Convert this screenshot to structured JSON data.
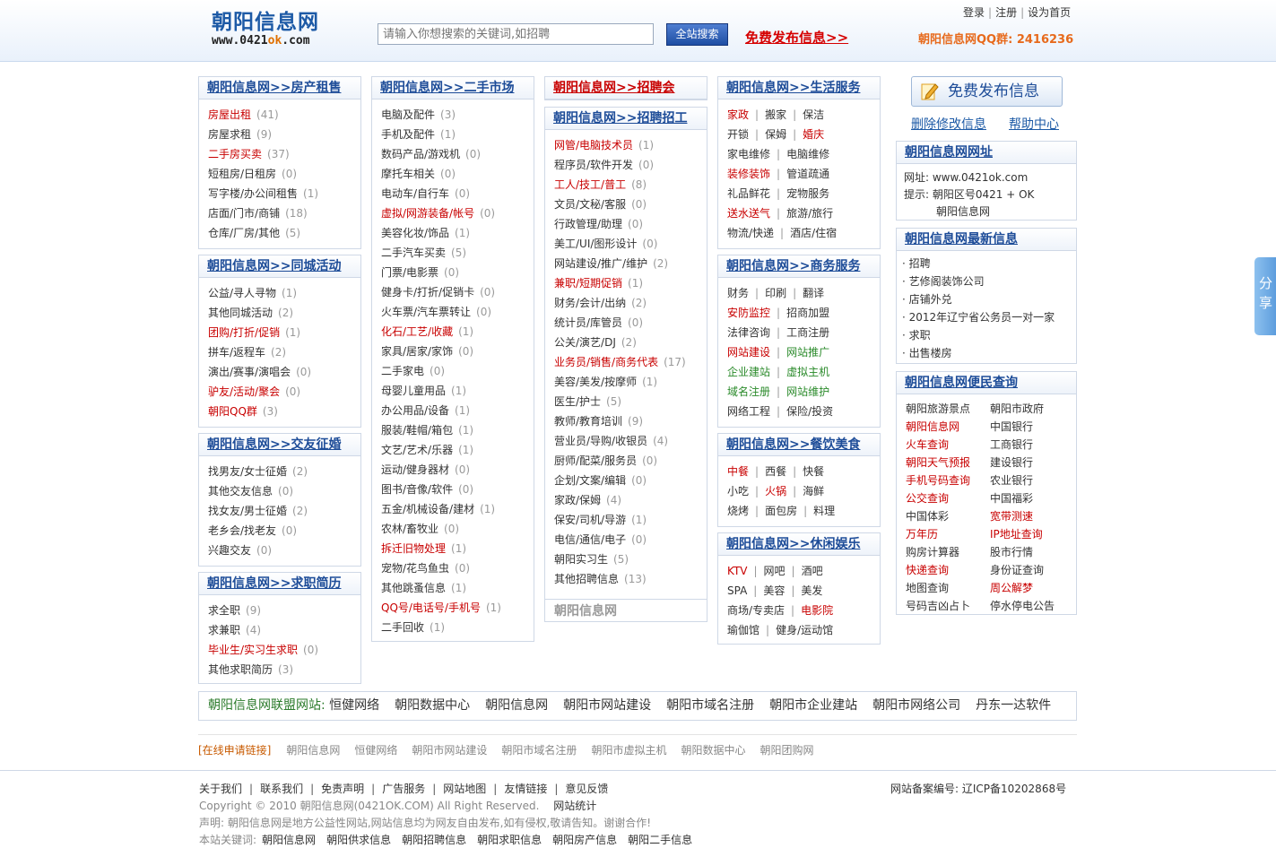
{
  "header": {
    "logo_title": "朝阳信息网",
    "logo_url_a": "www.0421",
    "logo_url_b": "ok",
    "logo_url_c": ".com",
    "search_placeholder": "请输入你想搜索的关键词,如招聘",
    "search_button": "全站搜索",
    "publish_link": "免费发布信息>>",
    "login": "登录",
    "register": "注册",
    "set_home": "设为首页",
    "qq_group": "朝阳信息网QQ群: 2416236"
  },
  "house": {
    "title": "朝阳信息网>>房产租售",
    "items": [
      {
        "label": "房屋出租",
        "count": "(41)",
        "red": true
      },
      {
        "label": "房屋求租",
        "count": "(9)",
        "red": false
      },
      {
        "label": "二手房买卖",
        "count": "(37)",
        "red": true
      },
      {
        "label": "短租房/日租房",
        "count": "(0)",
        "red": false
      },
      {
        "label": "写字楼/办公间租售",
        "count": "(1)",
        "red": false
      },
      {
        "label": "店面/门市/商铺",
        "count": "(18)",
        "red": false
      },
      {
        "label": "仓库/厂房/其他",
        "count": "(5)",
        "red": false
      }
    ]
  },
  "activity": {
    "title": "朝阳信息网>>同城活动",
    "items": [
      {
        "label": "公益/寻人寻物",
        "count": "(1)",
        "red": false
      },
      {
        "label": "其他同城活动",
        "count": "(2)",
        "red": false
      },
      {
        "label": "团购/打折/促销",
        "count": "(1)",
        "red": true
      },
      {
        "label": "拼车/返程车",
        "count": "(2)",
        "red": false
      },
      {
        "label": "演出/赛事/演唱会",
        "count": "(0)",
        "red": false
      },
      {
        "label": "驴友/活动/聚会",
        "count": "(0)",
        "red": true
      },
      {
        "label": "朝阳QQ群",
        "count": "(3)",
        "red": true
      }
    ]
  },
  "dating": {
    "title": "朝阳信息网>>交友征婚",
    "items": [
      {
        "label": "找男友/女士征婚",
        "count": "(2)",
        "red": false
      },
      {
        "label": "其他交友信息",
        "count": "(0)",
        "red": false
      },
      {
        "label": "找女友/男士征婚",
        "count": "(2)",
        "red": false
      },
      {
        "label": "老乡会/找老友",
        "count": "(0)",
        "red": false
      },
      {
        "label": "兴趣交友",
        "count": "(0)",
        "red": false
      }
    ]
  },
  "resume": {
    "title": "朝阳信息网>>求职简历",
    "items": [
      {
        "label": "求全职",
        "count": "(9)",
        "red": false
      },
      {
        "label": "求兼职",
        "count": "(4)",
        "red": false
      },
      {
        "label": "毕业生/实习生求职",
        "count": "(0)",
        "red": true
      },
      {
        "label": "其他求职简历",
        "count": "(3)",
        "red": false
      }
    ]
  },
  "secondhand": {
    "title": "朝阳信息网>>二手市场",
    "items": [
      {
        "label": "电脑及配件",
        "count": "(3)",
        "red": false
      },
      {
        "label": "手机及配件",
        "count": "(1)",
        "red": false
      },
      {
        "label": "数码产品/游戏机",
        "count": "(0)",
        "red": false
      },
      {
        "label": "摩托车相关",
        "count": "(0)",
        "red": false
      },
      {
        "label": "电动车/自行车",
        "count": "(0)",
        "red": false
      },
      {
        "label": "虚拟/网游装备/帐号",
        "count": "(0)",
        "red": true
      },
      {
        "label": "美容化妆/饰品",
        "count": "(1)",
        "red": false
      },
      {
        "label": "二手汽车买卖",
        "count": "(5)",
        "red": false
      },
      {
        "label": "门票/电影票",
        "count": "(0)",
        "red": false
      },
      {
        "label": "健身卡/打折/促销卡",
        "count": "(0)",
        "red": false
      },
      {
        "label": "火车票/汽车票转让",
        "count": "(0)",
        "red": false
      },
      {
        "label": "化石/工艺/收藏",
        "count": "(1)",
        "red": true
      },
      {
        "label": "家具/居家/家饰",
        "count": "(0)",
        "red": false
      },
      {
        "label": "二手家电",
        "count": "(0)",
        "red": false
      },
      {
        "label": "母婴儿童用品",
        "count": "(1)",
        "red": false
      },
      {
        "label": "办公用品/设备",
        "count": "(1)",
        "red": false
      },
      {
        "label": "服装/鞋帽/箱包",
        "count": "(1)",
        "red": false
      },
      {
        "label": "文艺/艺术/乐器",
        "count": "(1)",
        "red": false
      },
      {
        "label": "运动/健身器材",
        "count": "(0)",
        "red": false
      },
      {
        "label": "图书/音像/软件",
        "count": "(0)",
        "red": false
      },
      {
        "label": "五金/机械设备/建材",
        "count": "(1)",
        "red": false
      },
      {
        "label": "农林/畜牧业",
        "count": "(0)",
        "red": false
      },
      {
        "label": "拆迁旧物处理",
        "count": "(1)",
        "red": true
      },
      {
        "label": "宠物/花鸟鱼虫",
        "count": "(0)",
        "red": false
      },
      {
        "label": "其他跳蚤信息",
        "count": "(1)",
        "red": false
      },
      {
        "label": "QQ号/电话号/手机号",
        "count": "(1)",
        "red": true
      },
      {
        "label": "二手回收",
        "count": "(1)",
        "red": false
      }
    ]
  },
  "fair": {
    "title": "朝阳信息网>>招聘会"
  },
  "jobs": {
    "title": "朝阳信息网>>招聘招工",
    "footer": "朝阳信息网",
    "items": [
      {
        "label": "网管/电脑技术员",
        "count": "(1)",
        "red": true
      },
      {
        "label": "程序员/软件开发",
        "count": "(0)",
        "red": false
      },
      {
        "label": "工人/技工/普工",
        "count": "(8)",
        "red": true
      },
      {
        "label": "文员/文秘/客服",
        "count": "(0)",
        "red": false
      },
      {
        "label": "行政管理/助理",
        "count": "(0)",
        "red": false
      },
      {
        "label": "美工/UI/图形设计",
        "count": "(0)",
        "red": false
      },
      {
        "label": "网站建设/推广/维护",
        "count": "(2)",
        "red": false
      },
      {
        "label": "兼职/短期促销",
        "count": "(1)",
        "red": true
      },
      {
        "label": "财务/会计/出纳",
        "count": "(2)",
        "red": false
      },
      {
        "label": "统计员/库管员",
        "count": "(0)",
        "red": false
      },
      {
        "label": "公关/演艺/DJ",
        "count": "(2)",
        "red": false
      },
      {
        "label": "业务员/销售/商务代表",
        "count": "(17)",
        "red": true
      },
      {
        "label": "美容/美发/按摩师",
        "count": "(1)",
        "red": false
      },
      {
        "label": "医生/护士",
        "count": "(5)",
        "red": false
      },
      {
        "label": "教师/教育培训",
        "count": "(9)",
        "red": false
      },
      {
        "label": "营业员/导购/收银员",
        "count": "(4)",
        "red": false
      },
      {
        "label": "厨师/配菜/服务员",
        "count": "(0)",
        "red": false
      },
      {
        "label": "企划/文案/编辑",
        "count": "(0)",
        "red": false
      },
      {
        "label": "家政/保姆",
        "count": "(4)",
        "red": false
      },
      {
        "label": "保安/司机/导游",
        "count": "(1)",
        "red": false
      },
      {
        "label": "电信/通信/电子",
        "count": "(0)",
        "red": false
      },
      {
        "label": "朝阳实习生",
        "count": "(5)",
        "red": false
      },
      {
        "label": "其他招聘信息",
        "count": "(13)",
        "red": false
      }
    ]
  },
  "life": {
    "title": "朝阳信息网>>生活服务",
    "rows": [
      [
        {
          "t": "家政",
          "c": "red"
        },
        {
          "t": "搬家",
          "c": ""
        },
        {
          "t": "保洁",
          "c": ""
        }
      ],
      [
        {
          "t": "开锁",
          "c": ""
        },
        {
          "t": "保姆",
          "c": ""
        },
        {
          "t": "婚庆",
          "c": "red"
        }
      ],
      [
        {
          "t": "家电维修",
          "c": ""
        },
        {
          "t": "电脑维修",
          "c": ""
        }
      ],
      [
        {
          "t": "装修装饰",
          "c": "red"
        },
        {
          "t": "管道疏通",
          "c": ""
        }
      ],
      [
        {
          "t": "礼品鲜花",
          "c": ""
        },
        {
          "t": "宠物服务",
          "c": ""
        }
      ],
      [
        {
          "t": "送水送气",
          "c": "red"
        },
        {
          "t": "旅游/旅行",
          "c": ""
        }
      ],
      [
        {
          "t": "物流/快递",
          "c": ""
        },
        {
          "t": "酒店/住宿",
          "c": ""
        }
      ]
    ]
  },
  "business": {
    "title": "朝阳信息网>>商务服务",
    "rows": [
      [
        {
          "t": "财务",
          "c": ""
        },
        {
          "t": "印刷",
          "c": ""
        },
        {
          "t": "翻译",
          "c": ""
        }
      ],
      [
        {
          "t": "安防监控",
          "c": "red"
        },
        {
          "t": "招商加盟",
          "c": ""
        }
      ],
      [
        {
          "t": "法律咨询",
          "c": ""
        },
        {
          "t": "工商注册",
          "c": ""
        }
      ],
      [
        {
          "t": "网站建设",
          "c": "red"
        },
        {
          "t": "网站推广",
          "c": "green"
        }
      ],
      [
        {
          "t": "企业建站",
          "c": "green"
        },
        {
          "t": "虚拟主机",
          "c": "green"
        }
      ],
      [
        {
          "t": "域名注册",
          "c": "green"
        },
        {
          "t": "网站维护",
          "c": "green"
        }
      ],
      [
        {
          "t": "网络工程",
          "c": ""
        },
        {
          "t": "保险/投资",
          "c": ""
        }
      ]
    ]
  },
  "food": {
    "title": "朝阳信息网>>餐饮美食",
    "rows": [
      [
        {
          "t": "中餐",
          "c": "red"
        },
        {
          "t": "西餐",
          "c": ""
        },
        {
          "t": "快餐",
          "c": ""
        }
      ],
      [
        {
          "t": "小吃",
          "c": ""
        },
        {
          "t": "火锅",
          "c": "red"
        },
        {
          "t": "海鲜",
          "c": ""
        }
      ],
      [
        {
          "t": "烧烤",
          "c": ""
        },
        {
          "t": "面包房",
          "c": ""
        },
        {
          "t": "料理",
          "c": ""
        }
      ]
    ]
  },
  "leisure": {
    "title": "朝阳信息网>>休闲娱乐",
    "rows": [
      [
        {
          "t": "KTV",
          "c": "red"
        },
        {
          "t": "网吧",
          "c": ""
        },
        {
          "t": "酒吧",
          "c": ""
        }
      ],
      [
        {
          "t": "SPA",
          "c": ""
        },
        {
          "t": "美容",
          "c": ""
        },
        {
          "t": "美发",
          "c": ""
        }
      ],
      [
        {
          "t": "商场/专卖店",
          "c": ""
        },
        {
          "t": "电影院",
          "c": "red"
        }
      ],
      [
        {
          "t": "瑜伽馆",
          "c": ""
        },
        {
          "t": "健身/运动馆",
          "c": ""
        }
      ]
    ]
  },
  "sidebar": {
    "publish_button": "免费发布信息",
    "delete_edit": "删除修改信息",
    "help": "帮助中心",
    "site_title": "朝阳信息网网址",
    "site_line1": "网址: www.0421ok.com",
    "site_line2": "提示: 朝阳区号0421 + OK",
    "site_line3": "朝阳信息网",
    "latest_title": "朝阳信息网最新信息",
    "latest": [
      "招聘",
      "艺修阁装饰公司",
      "店铺外兑",
      "2012年辽宁省公务员一对一家",
      "求职",
      "出售楼房"
    ],
    "convenience_title": "朝阳信息网便民查询",
    "convenience": [
      {
        "t": "朝阳旅游景点",
        "c": ""
      },
      {
        "t": "朝阳市政府",
        "c": ""
      },
      {
        "t": "朝阳信息网",
        "c": "red"
      },
      {
        "t": "中国银行",
        "c": ""
      },
      {
        "t": "火车查询",
        "c": "red"
      },
      {
        "t": "工商银行",
        "c": ""
      },
      {
        "t": "朝阳天气预报",
        "c": "red"
      },
      {
        "t": "建设银行",
        "c": ""
      },
      {
        "t": "手机号码查询",
        "c": "red"
      },
      {
        "t": "农业银行",
        "c": ""
      },
      {
        "t": "公交查询",
        "c": "red"
      },
      {
        "t": "中国福彩",
        "c": ""
      },
      {
        "t": "中国体彩",
        "c": ""
      },
      {
        "t": "宽带测速",
        "c": "red"
      },
      {
        "t": "万年历",
        "c": "red"
      },
      {
        "t": "IP地址查询",
        "c": "red"
      },
      {
        "t": "购房计算器",
        "c": ""
      },
      {
        "t": "股市行情",
        "c": ""
      },
      {
        "t": "快递查询",
        "c": "red"
      },
      {
        "t": "身份证查询",
        "c": ""
      },
      {
        "t": "地图查询",
        "c": ""
      },
      {
        "t": "周公解梦",
        "c": "red"
      },
      {
        "t": "号码吉凶占卜",
        "c": ""
      },
      {
        "t": "停水停电公告",
        "c": ""
      }
    ]
  },
  "share": "分享",
  "union": {
    "label": "朝阳信息网联盟网站:",
    "links": [
      "恒健网络",
      "朝阳数据中心",
      "朝阳信息网",
      "朝阳市网站建设",
      "朝阳市域名注册",
      "朝阳市企业建站",
      "朝阳市网络公司",
      "丹东一达软件"
    ]
  },
  "friend_links": {
    "apply": "[在线申请链接]",
    "links": [
      "朝阳信息网",
      "恒健网络",
      "朝阳市网站建设",
      "朝阳市域名注册",
      "朝阳市虚拟主机",
      "朝阳数据中心",
      "朝阳团购网"
    ]
  },
  "footer": {
    "links": [
      "关于我们",
      "联系我们",
      "免责声明",
      "广告服务",
      "网站地图",
      "友情链接",
      "意见反馈"
    ],
    "icp": "网站备案编号: 辽ICP备10202868号",
    "copyright": "Copyright © 2010 朝阳信息网(0421OK.COM) All Right Reserved.",
    "stats": "网站统计",
    "statement": "声明: 朝阳信息网是地方公益性网站,网站信息均为网友自由发布,如有侵权,敬请告知。谢谢合作!",
    "keywords_label": "本站关键词:",
    "keywords": [
      "朝阳信息网",
      "朝阳供求信息",
      "朝阳招聘信息",
      "朝阳求职信息",
      "朝阳房产信息",
      "朝阳二手信息"
    ]
  }
}
